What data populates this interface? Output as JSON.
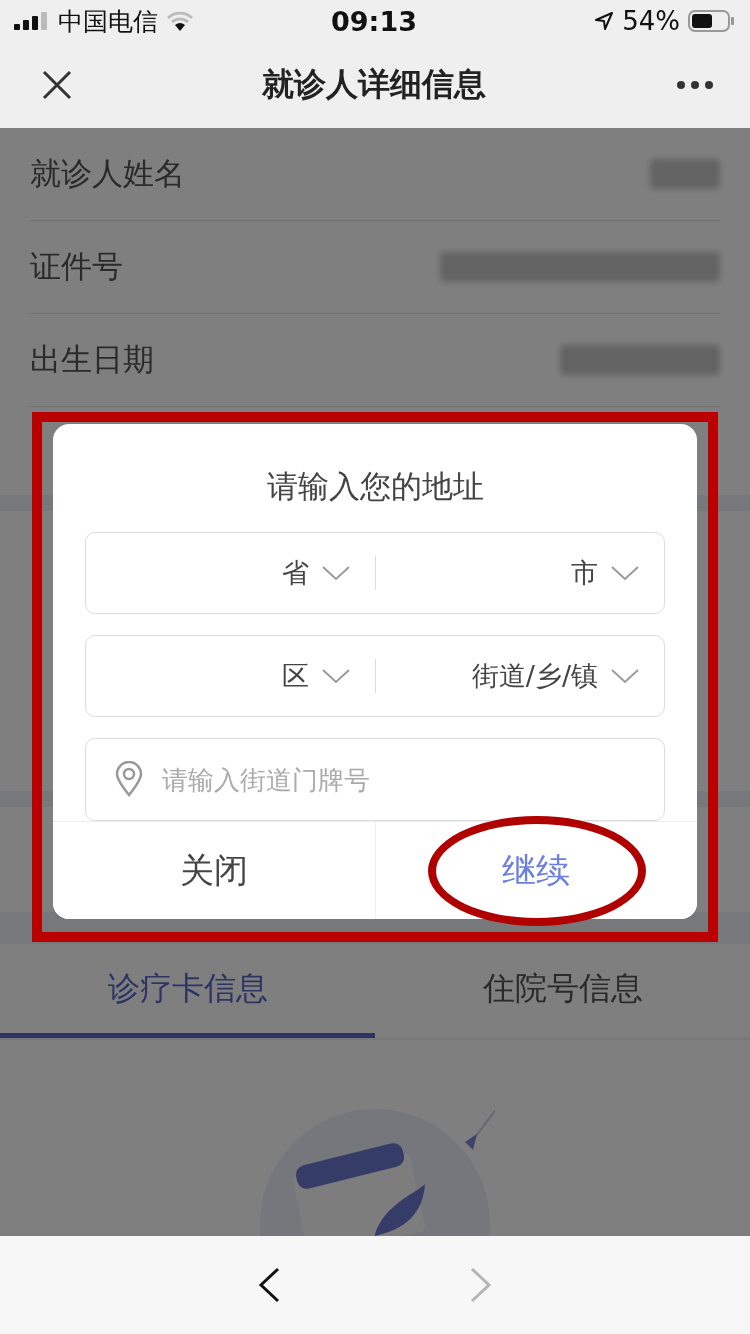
{
  "status_bar": {
    "carrier": "中国电信",
    "time": "09:13",
    "battery": "54%"
  },
  "nav": {
    "title": "就诊人详细信息"
  },
  "fields": [
    {
      "label": "就诊人姓名"
    },
    {
      "label": "证件号"
    },
    {
      "label": "出生日期"
    }
  ],
  "tabs": [
    {
      "label": "诊疗卡信息",
      "selected": true
    },
    {
      "label": "住院号信息",
      "selected": false
    }
  ],
  "dialog": {
    "title": "请输入您的地址",
    "selects": [
      {
        "label": "省"
      },
      {
        "label": "市"
      },
      {
        "label": "区"
      },
      {
        "label": "街道/乡/镇"
      }
    ],
    "address": {
      "placeholder": "请输入街道门牌号"
    },
    "buttons": [
      {
        "label": "关闭",
        "kind": "cancel"
      },
      {
        "label": "继续",
        "kind": "confirm"
      }
    ]
  },
  "toolbar": [
    {
      "kind": "back",
      "disabled": false
    },
    {
      "kind": "forward",
      "disabled": true
    }
  ]
}
